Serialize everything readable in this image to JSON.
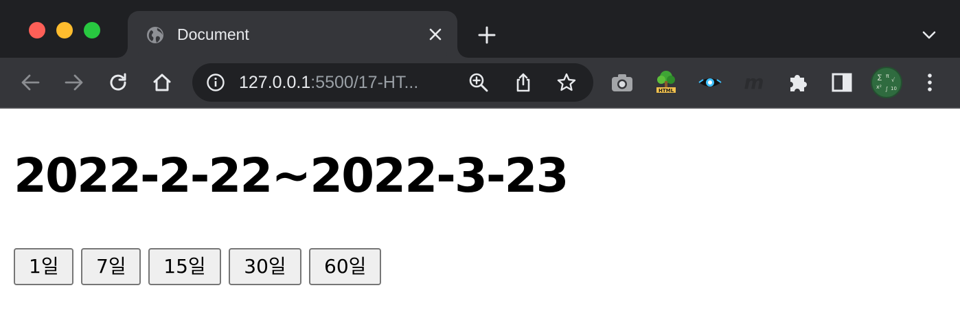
{
  "browser": {
    "tab": {
      "title": "Document",
      "favicon": "globe-icon"
    },
    "omnibox": {
      "host": "127.0.0.1",
      "path": ":5500/17-HT..."
    },
    "extensions": [
      "camera-extension-icon",
      "html-tree-extension-icon",
      "eye-extension-icon",
      "m-extension-icon",
      "puzzle-extensions-icon",
      "sidepanel-icon",
      "profile-avatar"
    ],
    "colors": {
      "frame": "#1f2023",
      "toolbar": "#35363a",
      "omnibox": "#202124"
    }
  },
  "page": {
    "heading": "2022-2-22~2022-3-23",
    "buttons": [
      {
        "label": "1일"
      },
      {
        "label": "7일"
      },
      {
        "label": "15일"
      },
      {
        "label": "30일"
      },
      {
        "label": "60일"
      }
    ]
  }
}
